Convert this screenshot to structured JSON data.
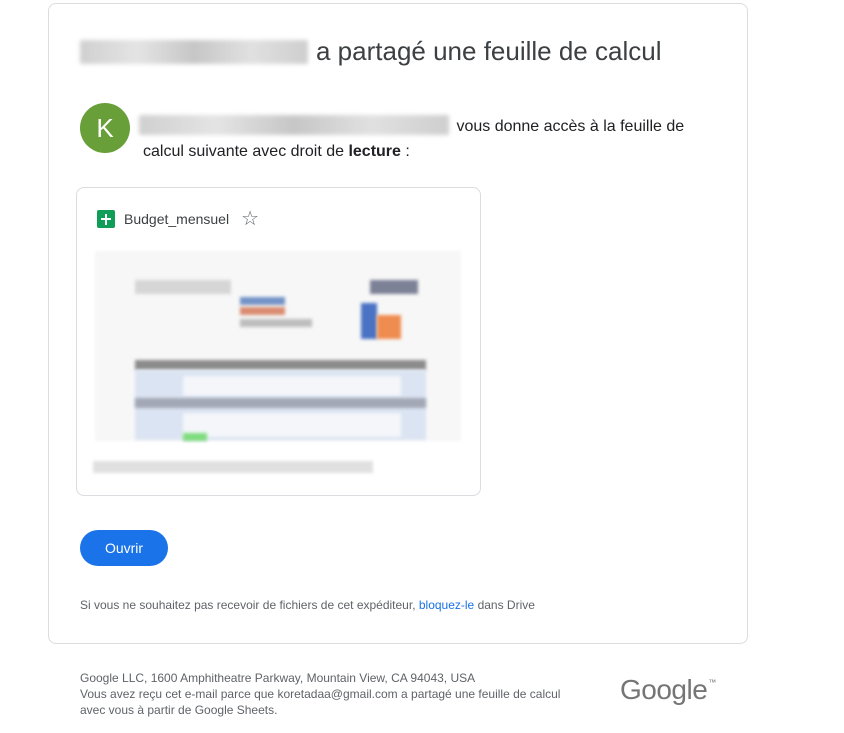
{
  "email": {
    "headline_suffix": "a partagé une feuille de calcul",
    "avatar_letter": "K",
    "message_suffix": " vous donne accès à la feuille de calcul suivante avec droit de ",
    "permission": "lecture",
    "message_end": " :",
    "file": {
      "name": "Budget_mensuel",
      "icon": "google-sheets-icon",
      "star_icon": "star-outline-icon"
    },
    "open_button": "Ouvrir",
    "unsubscribe_prefix": "Si vous ne souhaitez pas recevoir de fichiers de cet expéditeur, ",
    "unsubscribe_link": "bloquez-le",
    "unsubscribe_suffix": " dans Drive"
  },
  "footer": {
    "address": "Google LLC, 1600 Amphitheatre Parkway, Mountain View, CA 94043, USA",
    "notice_line1": "Vous avez reçu cet e-mail parce que koretadaa@gmail.com a partagé une feuille de calcul",
    "notice_line2": "avec vous à partir de Google Sheets.",
    "logo_text": "Google",
    "logo_tm": "™"
  },
  "colors": {
    "accent": "#1a73e8",
    "avatar": "#689f38",
    "sheets": "#0f9d58"
  }
}
